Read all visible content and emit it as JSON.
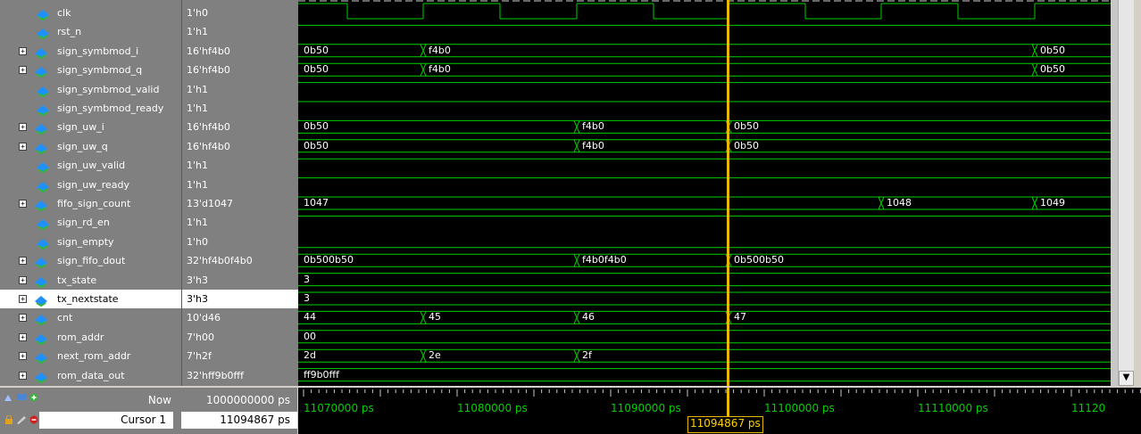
{
  "signals": [
    {
      "name": "clk",
      "value": "1'h0",
      "expandable": false
    },
    {
      "name": "rst_n",
      "value": "1'h1",
      "expandable": false
    },
    {
      "name": "sign_symbmod_i",
      "value": "16'hf4b0",
      "expandable": true
    },
    {
      "name": "sign_symbmod_q",
      "value": "16'hf4b0",
      "expandable": true
    },
    {
      "name": "sign_symbmod_valid",
      "value": "1'h1",
      "expandable": false
    },
    {
      "name": "sign_symbmod_ready",
      "value": "1'h1",
      "expandable": false
    },
    {
      "name": "sign_uw_i",
      "value": "16'hf4b0",
      "expandable": true
    },
    {
      "name": "sign_uw_q",
      "value": "16'hf4b0",
      "expandable": true
    },
    {
      "name": "sign_uw_valid",
      "value": "1'h1",
      "expandable": false
    },
    {
      "name": "sign_uw_ready",
      "value": "1'h1",
      "expandable": false
    },
    {
      "name": "fifo_sign_count",
      "value": "13'd1047",
      "expandable": true
    },
    {
      "name": "sign_rd_en",
      "value": "1'h1",
      "expandable": false
    },
    {
      "name": "sign_empty",
      "value": "1'h0",
      "expandable": false
    },
    {
      "name": "sign_fifo_dout",
      "value": "32'hf4b0f4b0",
      "expandable": true
    },
    {
      "name": "tx_state",
      "value": "3'h3",
      "expandable": true
    },
    {
      "name": "tx_nextstate",
      "value": "3'h3",
      "expandable": true,
      "selected": true
    },
    {
      "name": "cnt",
      "value": "10'd46",
      "expandable": true
    },
    {
      "name": "rom_addr",
      "value": "7'h00",
      "expandable": true
    },
    {
      "name": "next_rom_addr",
      "value": "7'h2f",
      "expandable": true
    },
    {
      "name": "rom_data_out",
      "value": "32'hff9b0fff",
      "expandable": true
    }
  ],
  "bus_labels": {
    "sign_symbmod_i": [
      [
        "0b50",
        0
      ],
      [
        "f4b0",
        140
      ],
      [
        "0b50",
        825
      ]
    ],
    "sign_symbmod_q": [
      [
        "0b50",
        0
      ],
      [
        "f4b0",
        140
      ],
      [
        "0b50",
        825
      ]
    ],
    "sign_uw_i": [
      [
        "0b50",
        0
      ],
      [
        "f4b0",
        312
      ],
      [
        "0b50",
        482
      ]
    ],
    "sign_uw_q": [
      [
        "0b50",
        0
      ],
      [
        "f4b0",
        312
      ],
      [
        "0b50",
        482
      ]
    ],
    "fifo_sign_count": [
      [
        "1047",
        0
      ],
      [
        "1048",
        653
      ],
      [
        "1049",
        825
      ]
    ],
    "sign_fifo_dout": [
      [
        "0b500b50",
        0
      ],
      [
        "f4b0f4b0",
        312
      ],
      [
        "0b500b50",
        482
      ]
    ],
    "tx_state": [
      [
        "3",
        0
      ]
    ],
    "tx_nextstate": [
      [
        "3",
        0
      ]
    ],
    "cnt": [
      [
        "44",
        0
      ],
      [
        "45",
        140
      ],
      [
        "46",
        312
      ],
      [
        "47",
        482
      ]
    ],
    "rom_addr": [
      [
        "00",
        0
      ]
    ],
    "next_rom_addr": [
      [
        "2d",
        0
      ],
      [
        "2e",
        140
      ],
      [
        "2f",
        312
      ]
    ],
    "rom_data_out": [
      [
        "ff9b0fff",
        0
      ]
    ]
  },
  "footer": {
    "now_label": "Now",
    "now_value": "1000000000 ps",
    "cursor_label": "Cursor 1",
    "cursor_value": "11094867 ps",
    "cursor_readout": "11094867 ps"
  },
  "timeline": {
    "ticks": [
      "11070000 ps",
      "11080000 ps",
      "11090000 ps",
      "11100000 ps",
      "11110000 ps",
      "11120"
    ]
  },
  "colors": {
    "wave": "#00d000",
    "cursor": "#e6b800",
    "signal_icon": "#1e90ff",
    "label": "#ffffff"
  }
}
